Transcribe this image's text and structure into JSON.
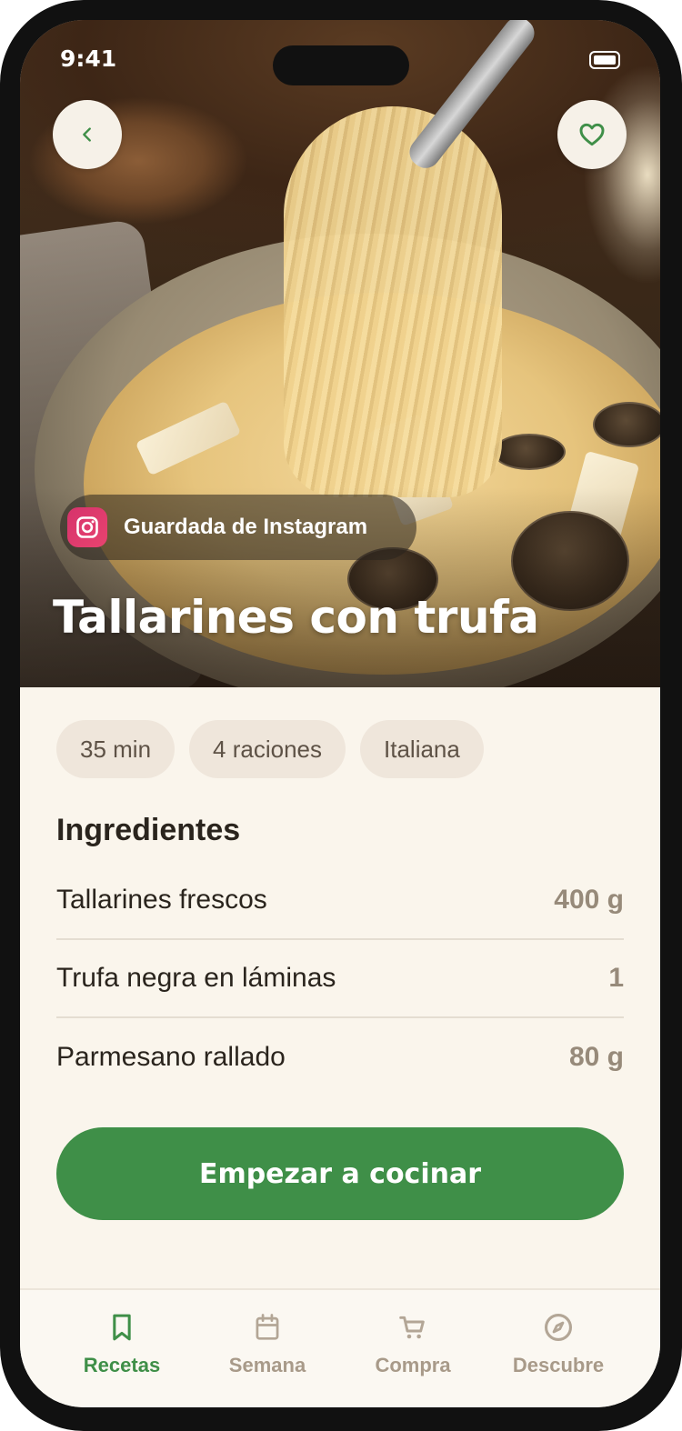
{
  "status_bar": {
    "time": "9:41"
  },
  "hero": {
    "source_label": "Guardada de Instagram",
    "source_icon": "instagram-icon",
    "title": "Tallarines con trufa"
  },
  "chips": [
    {
      "label": "35 min"
    },
    {
      "label": "4 raciones"
    },
    {
      "label": "Italiana"
    }
  ],
  "ingredients": {
    "title": "Ingredientes",
    "items": [
      {
        "name": "Tallarines frescos",
        "qty": "400 g"
      },
      {
        "name": "Trufa negra en láminas",
        "qty": "1"
      },
      {
        "name": "Parmesano rallado",
        "qty": "80 g"
      }
    ]
  },
  "cta": {
    "label": "Empezar a cocinar"
  },
  "tabs": [
    {
      "label": "Recetas",
      "icon": "bookmark-icon",
      "active": true
    },
    {
      "label": "Semana",
      "icon": "calendar-icon",
      "active": false
    },
    {
      "label": "Compra",
      "icon": "cart-icon",
      "active": false
    },
    {
      "label": "Descubre",
      "icon": "compass-icon",
      "active": false
    }
  ],
  "colors": {
    "accent": "#3f8f48",
    "background": "#faf5ec",
    "chip": "#efe6db",
    "instagram": "#d6336c"
  }
}
